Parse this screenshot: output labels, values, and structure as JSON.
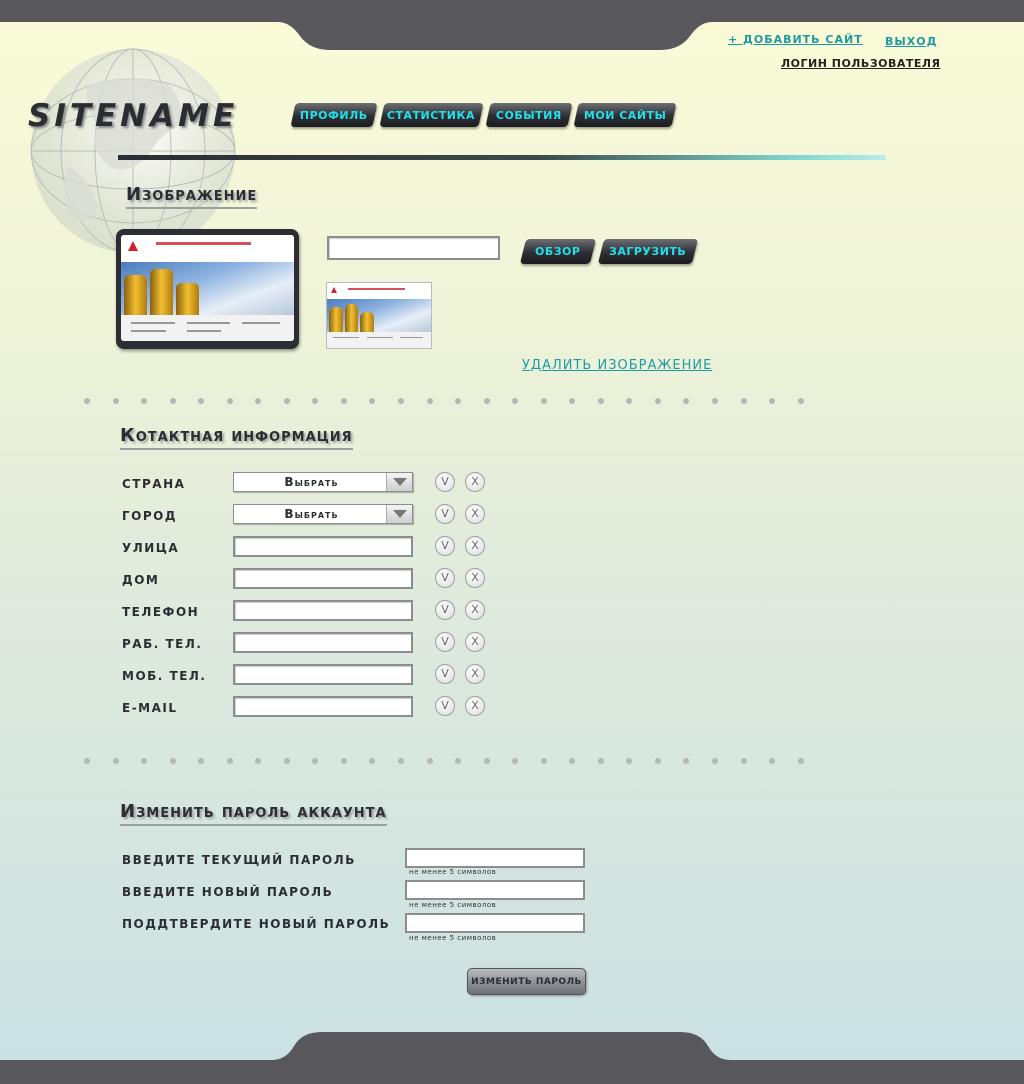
{
  "brand": {
    "logo": "SITENAME"
  },
  "top_links": {
    "add_site": "+ ДОБАВИТЬ САЙТ",
    "logout": "ВЫХОД",
    "user_login": "ЛОГИН ПОЛЬЗОВАТЕЛЯ"
  },
  "nav": {
    "items": [
      "ПРОФИЛЬ",
      "СТАТИСТИКА",
      "СОБЫТИЯ",
      "МОИ САЙТЫ"
    ]
  },
  "image_section": {
    "heading": "Изображение",
    "file_path_value": "",
    "browse_label": "ОБЗОР",
    "upload_label": "ЗАГРУЗИТЬ",
    "delete_label": "УДАЛИТЬ ИЗОБРАЖЕНИЕ"
  },
  "contact_section": {
    "heading": "Котактная информация",
    "fields": [
      {
        "label": "СТРАНА",
        "type": "select",
        "value": "Выбрать"
      },
      {
        "label": "ГОРОД",
        "type": "select",
        "value": "Выбрать"
      },
      {
        "label": "УЛИЦА",
        "type": "text",
        "value": ""
      },
      {
        "label": "ДОМ",
        "type": "text",
        "value": ""
      },
      {
        "label": "ТЕЛЕФОН",
        "type": "text",
        "value": ""
      },
      {
        "label": "РАБ. ТЕЛ.",
        "type": "text",
        "value": ""
      },
      {
        "label": "МОБ. ТЕЛ.",
        "type": "text",
        "value": ""
      },
      {
        "label": "E-MAIL",
        "type": "text",
        "value": ""
      }
    ],
    "confirm_glyph": "V",
    "clear_glyph": "X"
  },
  "password_section": {
    "heading": "Изменить пароль аккаунта",
    "fields": [
      {
        "label": "ВВЕДИТЕ ТЕКУЩИЙ ПАРОЛЬ",
        "value": "",
        "hint": "не менее 5 символов"
      },
      {
        "label": "ВВЕДИТЕ НОВЫЙ ПАРОЛЬ",
        "value": "",
        "hint": "не менее 5 символов"
      },
      {
        "label": "ПОДДТВЕРДИТЕ НОВЫЙ ПАРОЛЬ",
        "value": "",
        "hint": "не менее 5 символов"
      }
    ],
    "submit_label": "ИЗМЕНИТЬ ПАРОЛЬ"
  },
  "colors": {
    "accent": "#22e0ea",
    "link": "#1e9aa3",
    "dark": "#2c2e33",
    "frame": "#58575c"
  },
  "icons": [
    "globe-icon",
    "check-icon",
    "close-icon",
    "chevron-down-icon"
  ]
}
